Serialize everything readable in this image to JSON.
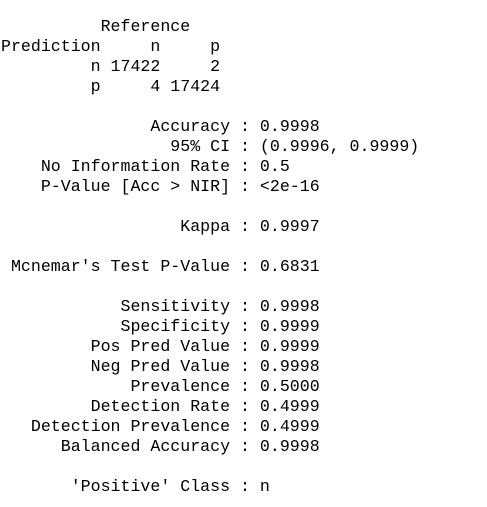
{
  "confusion_matrix": {
    "reference_header": "          Reference",
    "prediction_header": "Prediction     n     p",
    "row_n": "         n 17422     2",
    "row_p": "         p     4 17424"
  },
  "overall_stats": {
    "accuracy": "               Accuracy : 0.9998",
    "ci": "                 95% CI : (0.9996, 0.9999)",
    "nir": "    No Information Rate : 0.5",
    "pvalue": "    P-Value [Acc > NIR] : <2e-16",
    "kappa": "                  Kappa : 0.9997",
    "mcnemar": " Mcnemar's Test P-Value : 0.6831"
  },
  "class_stats": {
    "sensitivity": "            Sensitivity : 0.9998",
    "specificity": "            Specificity : 0.9999",
    "pos_pred": "         Pos Pred Value : 0.9999",
    "neg_pred": "         Neg Pred Value : 0.9998",
    "prevalence": "             Prevalence : 0.5000",
    "detection_rate": "         Detection Rate : 0.4999",
    "detection_prevalence": "   Detection Prevalence : 0.4999",
    "balanced_accuracy": "      Balanced Accuracy : 0.9998"
  },
  "positive_class": "       'Positive' Class : n"
}
